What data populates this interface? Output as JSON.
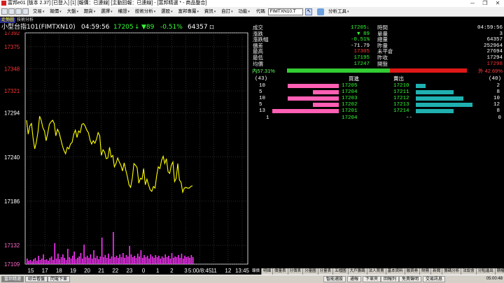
{
  "window": {
    "title": "富邦e01 [版本 2.37] [已登入] [1] [報價：已連線] [主動回報：已連線] - [富邦精選 * - 商品整合]",
    "buttons": [
      "─",
      "❐",
      "✕"
    ]
  },
  "menubar": {
    "items": [
      "交易",
      "報價",
      "大盤",
      "期貨",
      "選擇",
      "權證",
      "技術分析",
      "選股",
      "富邦專屬",
      "資訊",
      "自訂",
      "功能"
    ],
    "quote_label": "代碼",
    "quote_symbol": "FIMTXN10.T",
    "tools_label": "分析工具"
  },
  "chart": {
    "tabs": [
      "走勢圖",
      "技術分析"
    ],
    "header": {
      "name": "小型台指101(FIMTXN10)",
      "time": "04:59:56",
      "price": "17205",
      "arrow": "↓",
      "change": "▼89",
      "pct": "-0.51%",
      "volume": "64357",
      "flag": "口"
    },
    "colors": {
      "price_line": "#ffff00",
      "volume": "#ff33ff",
      "axis": "#ffffff",
      "grid": "#5a5a5a",
      "price_label": "#ff3333",
      "pink_label": "#ff66cc"
    }
  },
  "chart_data": {
    "type": "line",
    "title": "",
    "xlabel": "",
    "ylabel": "",
    "ylim": [
      17109,
      17392
    ],
    "yticks": [
      17392,
      17375,
      17348,
      17321,
      17294,
      17240,
      17186,
      17132,
      17109
    ],
    "y_highlight": [
      "17392",
      "17375",
      "17348",
      "17321"
    ],
    "y_highlight_low": [
      "17132",
      "17109"
    ],
    "xticks": [
      "15",
      "17",
      "18",
      "19",
      "20",
      "21",
      "22",
      "23",
      "0",
      "1",
      "2",
      "3",
      "5:00/8:45",
      "11",
      "12",
      "13:45"
    ],
    "series": [
      {
        "values": [
          17285,
          17268,
          17278,
          17281,
          17263,
          17250,
          17258,
          17271,
          17290,
          17285,
          17276,
          17272,
          17260,
          17269,
          17280,
          17283,
          17285,
          17281,
          17266,
          17274,
          17270,
          17262,
          17254,
          17248,
          17244,
          17252,
          17250,
          17256,
          17258,
          17268,
          17273,
          17264,
          17272,
          17270,
          17280,
          17281,
          17278,
          17273,
          17270,
          17261,
          17256,
          17260,
          17257,
          17262,
          17270,
          17266,
          17242,
          17249,
          17246,
          17238,
          17239,
          17252,
          17240,
          17242,
          17228,
          17232,
          17239,
          17234,
          17230,
          17223,
          17233,
          17224,
          17216,
          17206,
          17203,
          17214,
          17232,
          17230,
          17227,
          17208,
          17214,
          17213,
          17226,
          17206,
          17213,
          17206,
          17200,
          17198,
          17204,
          17202,
          17217,
          17228,
          17226,
          17236,
          17241,
          17232,
          17238,
          17222,
          17220,
          17230,
          17234,
          17210,
          17214,
          17232,
          17212,
          17209,
          17197,
          17202,
          17203,
          17202,
          17202,
          17204,
          17205
        ]
      }
    ],
    "volume": [
      8,
      5,
      6,
      4,
      7,
      9,
      5,
      12,
      6,
      8,
      14,
      6,
      7,
      5,
      9,
      11,
      6,
      30,
      8,
      15,
      7,
      10,
      14,
      9,
      6,
      22,
      10,
      8,
      12,
      18,
      7,
      9,
      11,
      16,
      8,
      28,
      10,
      12,
      9,
      14,
      8,
      20,
      9,
      12,
      7,
      11,
      38,
      10,
      13,
      9,
      15,
      8,
      11,
      46,
      10,
      12,
      9,
      14,
      10,
      16,
      9,
      13,
      11,
      26,
      14,
      10,
      12,
      9,
      15,
      11,
      20,
      9,
      13,
      10,
      12,
      8,
      14,
      11,
      9,
      13,
      10,
      12,
      8,
      11,
      9,
      14,
      10,
      12,
      8,
      16,
      9,
      11,
      10,
      13,
      9,
      15,
      8,
      12,
      10,
      11,
      9,
      13,
      10
    ]
  },
  "quote": {
    "left": [
      {
        "label": "成交",
        "value": "17205↓",
        "color": "#33ff33"
      },
      {
        "label": "漲跌",
        "value": "▼ 89",
        "color": "#33ff33"
      },
      {
        "label": "漲跌幅",
        "value": "-0.51%",
        "color": "#33ff33"
      },
      {
        "label": "價差",
        "value": "-71.79",
        "color": "#ffffff"
      },
      {
        "label": "最高",
        "value": "17305",
        "color": "#ff3333"
      },
      {
        "label": "最低",
        "value": "17195",
        "color": "#33ff33"
      },
      {
        "label": "均價",
        "value": "17247",
        "color": "#33ff33"
      }
    ],
    "right": [
      {
        "label": "時間",
        "value": "04:59:56",
        "color": "#ffffff"
      },
      {
        "label": "單量",
        "value": "3",
        "color": "#ffffff"
      },
      {
        "label": "總量",
        "value": "64357",
        "color": "#ffffff"
      },
      {
        "label": "昨量",
        "value": "252964",
        "color": "#ffffff"
      },
      {
        "label": "未平倉",
        "value": "27694",
        "color": "#ffffff"
      },
      {
        "label": "昨收",
        "value": "17294",
        "color": "#ffffff"
      },
      {
        "label": "開盤",
        "value": "17298",
        "color": "#ff3333"
      }
    ],
    "ratio": {
      "in_label": "內57.31%",
      "in_fraction": 0.5731,
      "out_label": "外 42.69%"
    },
    "orderbook": {
      "bid_total": "(43)",
      "bid_header": "買進",
      "ask_header": "賣出",
      "ask_total": "(40)",
      "rows": [
        {
          "bid_qty": "10",
          "bid": "17205",
          "ask": "17210",
          "ask_qty": "2",
          "bid_level": 10,
          "ask_level": 2
        },
        {
          "bid_qty": "5",
          "bid": "17204",
          "ask": "17211",
          "ask_qty": "8",
          "bid_level": 5,
          "ask_level": 8
        },
        {
          "bid_qty": "10",
          "bid": "17203",
          "ask": "17212",
          "ask_qty": "10",
          "bid_level": 10,
          "ask_level": 10
        },
        {
          "bid_qty": "5",
          "bid": "17202",
          "ask": "17213",
          "ask_qty": "12",
          "bid_level": 5,
          "ask_level": 12
        },
        {
          "bid_qty": "13",
          "bid": "17201",
          "ask": "17214",
          "ask_qty": "8",
          "bid_level": 13,
          "ask_level": 8
        }
      ],
      "summary": {
        "left": "1",
        "mid": "17204",
        "dash": "--",
        "right": "0"
      }
    }
  },
  "bottom_tabs": [
    "報價",
    "明細",
    "價量表",
    "分價表",
    "分量圖",
    "分量表",
    "五檔圖",
    "大戶籌碼",
    "法人買賣",
    "基本資料",
    "融資券",
    "財務",
    "新聞",
    "籌碼分析",
    "法說會",
    "分點進出",
    "期權買賣"
  ],
  "statusbar": {
    "windows": [
      "富邦精選",
      "綜合看盤",
      "閃電下單"
    ],
    "items": [
      "智能選股",
      "通報",
      "下單夾",
      "回報列",
      "免責聲明",
      "交易訊息"
    ],
    "clock": "05:00:48"
  }
}
